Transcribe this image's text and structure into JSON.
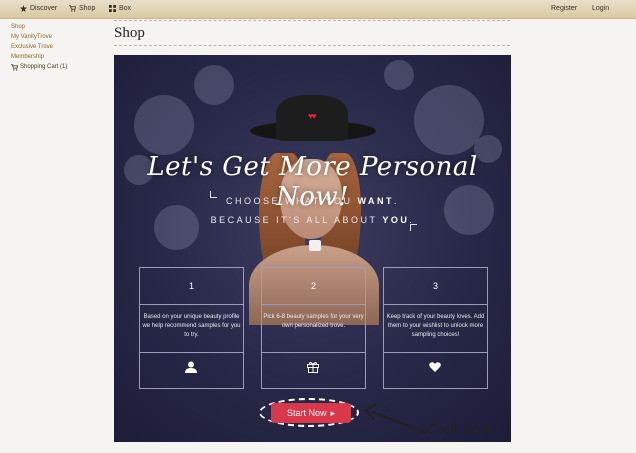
{
  "nav": {
    "discover": "Discover",
    "shop": "Shop",
    "box": "Box",
    "register": "Register",
    "login": "Login"
  },
  "sidebar": {
    "items": [
      "Shop",
      "My VanityTrove",
      "Exclusive Trove",
      "Membership"
    ],
    "cart": "Shopping Cart (1)"
  },
  "page": {
    "title": "Shop"
  },
  "hero": {
    "headline": "Let's Get More Personal Now!",
    "sub1_pre": "CHOOSE WHAT YOU ",
    "sub1_bold": "WANT",
    "sub1_post": ".",
    "sub2_pre": "BECAUSE IT'S ALL ABOUT ",
    "sub2_bold": "YOU",
    "sub2_post": "."
  },
  "steps": [
    {
      "number": "1",
      "text": "Based on your unique beauty profile we help recommend samples for you to try.",
      "icon": "user-icon"
    },
    {
      "number": "2",
      "text": "Pick 6-8 beauty samples for your very own personalized trove.",
      "icon": "gift-icon"
    },
    {
      "number": "3",
      "text": "Keep track of your beauty loves. Add them to your wishlist to unlock more sampling choices!",
      "icon": "heart-icon"
    }
  ],
  "cta": {
    "label": "Start Now",
    "arrow": "▸"
  },
  "annotation": {
    "text": "Click Here!"
  },
  "colors": {
    "accent": "#d9374a",
    "hero_bg": "#272747",
    "topbar": "#e2d6ba"
  }
}
